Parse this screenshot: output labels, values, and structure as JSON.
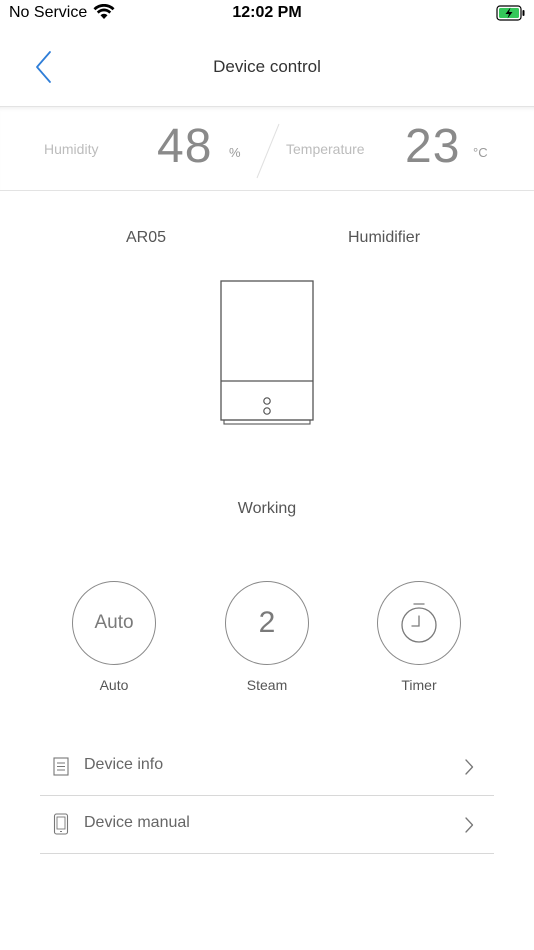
{
  "status_bar": {
    "carrier": "No Service",
    "time": "12:02 PM"
  },
  "nav": {
    "title": "Device control"
  },
  "sensors": {
    "humidity": {
      "label": "Humidity",
      "value": "48",
      "unit": "%"
    },
    "temperature": {
      "label": "Temperature",
      "value": "23",
      "unit": "°C"
    }
  },
  "device": {
    "model": "AR05",
    "type": "Humidifier",
    "status": "Working"
  },
  "modes": [
    {
      "label": "Auto",
      "display": "Auto"
    },
    {
      "label": "Steam",
      "display": "2"
    },
    {
      "label": "Timer"
    }
  ],
  "list": [
    {
      "label": "Device info",
      "icon": "document-icon"
    },
    {
      "label": "Device manual",
      "icon": "phone-icon"
    }
  ],
  "colors": {
    "accent": "#2f7ed8",
    "battery": "#34c759"
  }
}
